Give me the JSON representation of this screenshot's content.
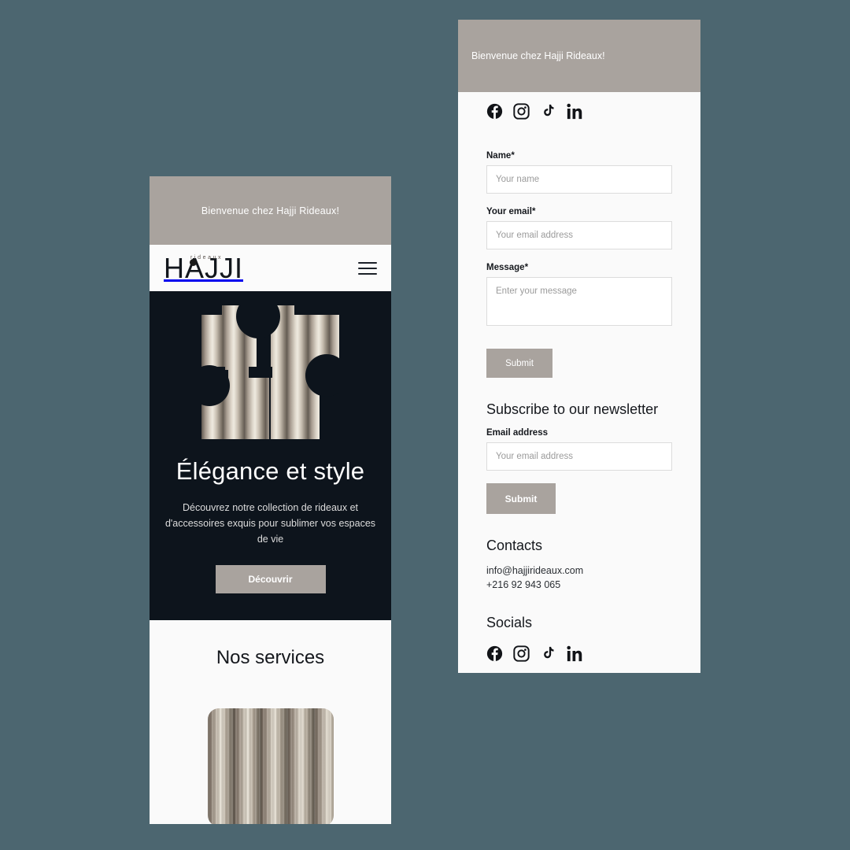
{
  "theme": {
    "page_background": "#4c6670",
    "accent_taupe": "#a9a39e",
    "hero_dark": "#0d141c",
    "panel_light": "#fafafa"
  },
  "left_panel": {
    "announcement": "Bienvenue chez Hajji Rideaux!",
    "logo": {
      "main": "HAJJI",
      "sub": "rideaux"
    },
    "menu_icon": "hamburger-menu-icon",
    "hero": {
      "title": "Élégance et style",
      "subtitle": "Découvrez notre collection de rideaux et d'accessoires exquis pour sublimer vos espaces de vie",
      "cta_label": "Découvrir",
      "art_alt": "curtain-pleats-letterform"
    },
    "services": {
      "title": "Nos services",
      "image_alt": "curtain-fabric-rolls"
    }
  },
  "right_panel": {
    "announcement": "Bienvenue chez Hajji Rideaux!",
    "socials_top": [
      {
        "name": "facebook-icon",
        "label": "Facebook"
      },
      {
        "name": "instagram-icon",
        "label": "Instagram"
      },
      {
        "name": "tiktok-icon",
        "label": "TikTok"
      },
      {
        "name": "linkedin-icon",
        "label": "LinkedIn"
      }
    ],
    "contact_form": {
      "name_label": "Name*",
      "name_placeholder": "Your name",
      "email_label": "Your email*",
      "email_placeholder": "Your email address",
      "message_label": "Message*",
      "message_placeholder": "Enter your message",
      "submit_label": "Submit"
    },
    "newsletter": {
      "title": "Subscribe to our newsletter",
      "email_label": "Email address",
      "email_placeholder": "Your email address",
      "submit_label": "Submit"
    },
    "contacts": {
      "title": "Contacts",
      "email": "info@hajjirideaux.com",
      "phone": "+216 92 943 065"
    },
    "socials": {
      "title": "Socials",
      "items": [
        {
          "name": "facebook-icon",
          "label": "Facebook"
        },
        {
          "name": "instagram-icon",
          "label": "Instagram"
        },
        {
          "name": "tiktok-icon",
          "label": "TikTok"
        },
        {
          "name": "linkedin-icon",
          "label": "LinkedIn"
        }
      ]
    }
  }
}
